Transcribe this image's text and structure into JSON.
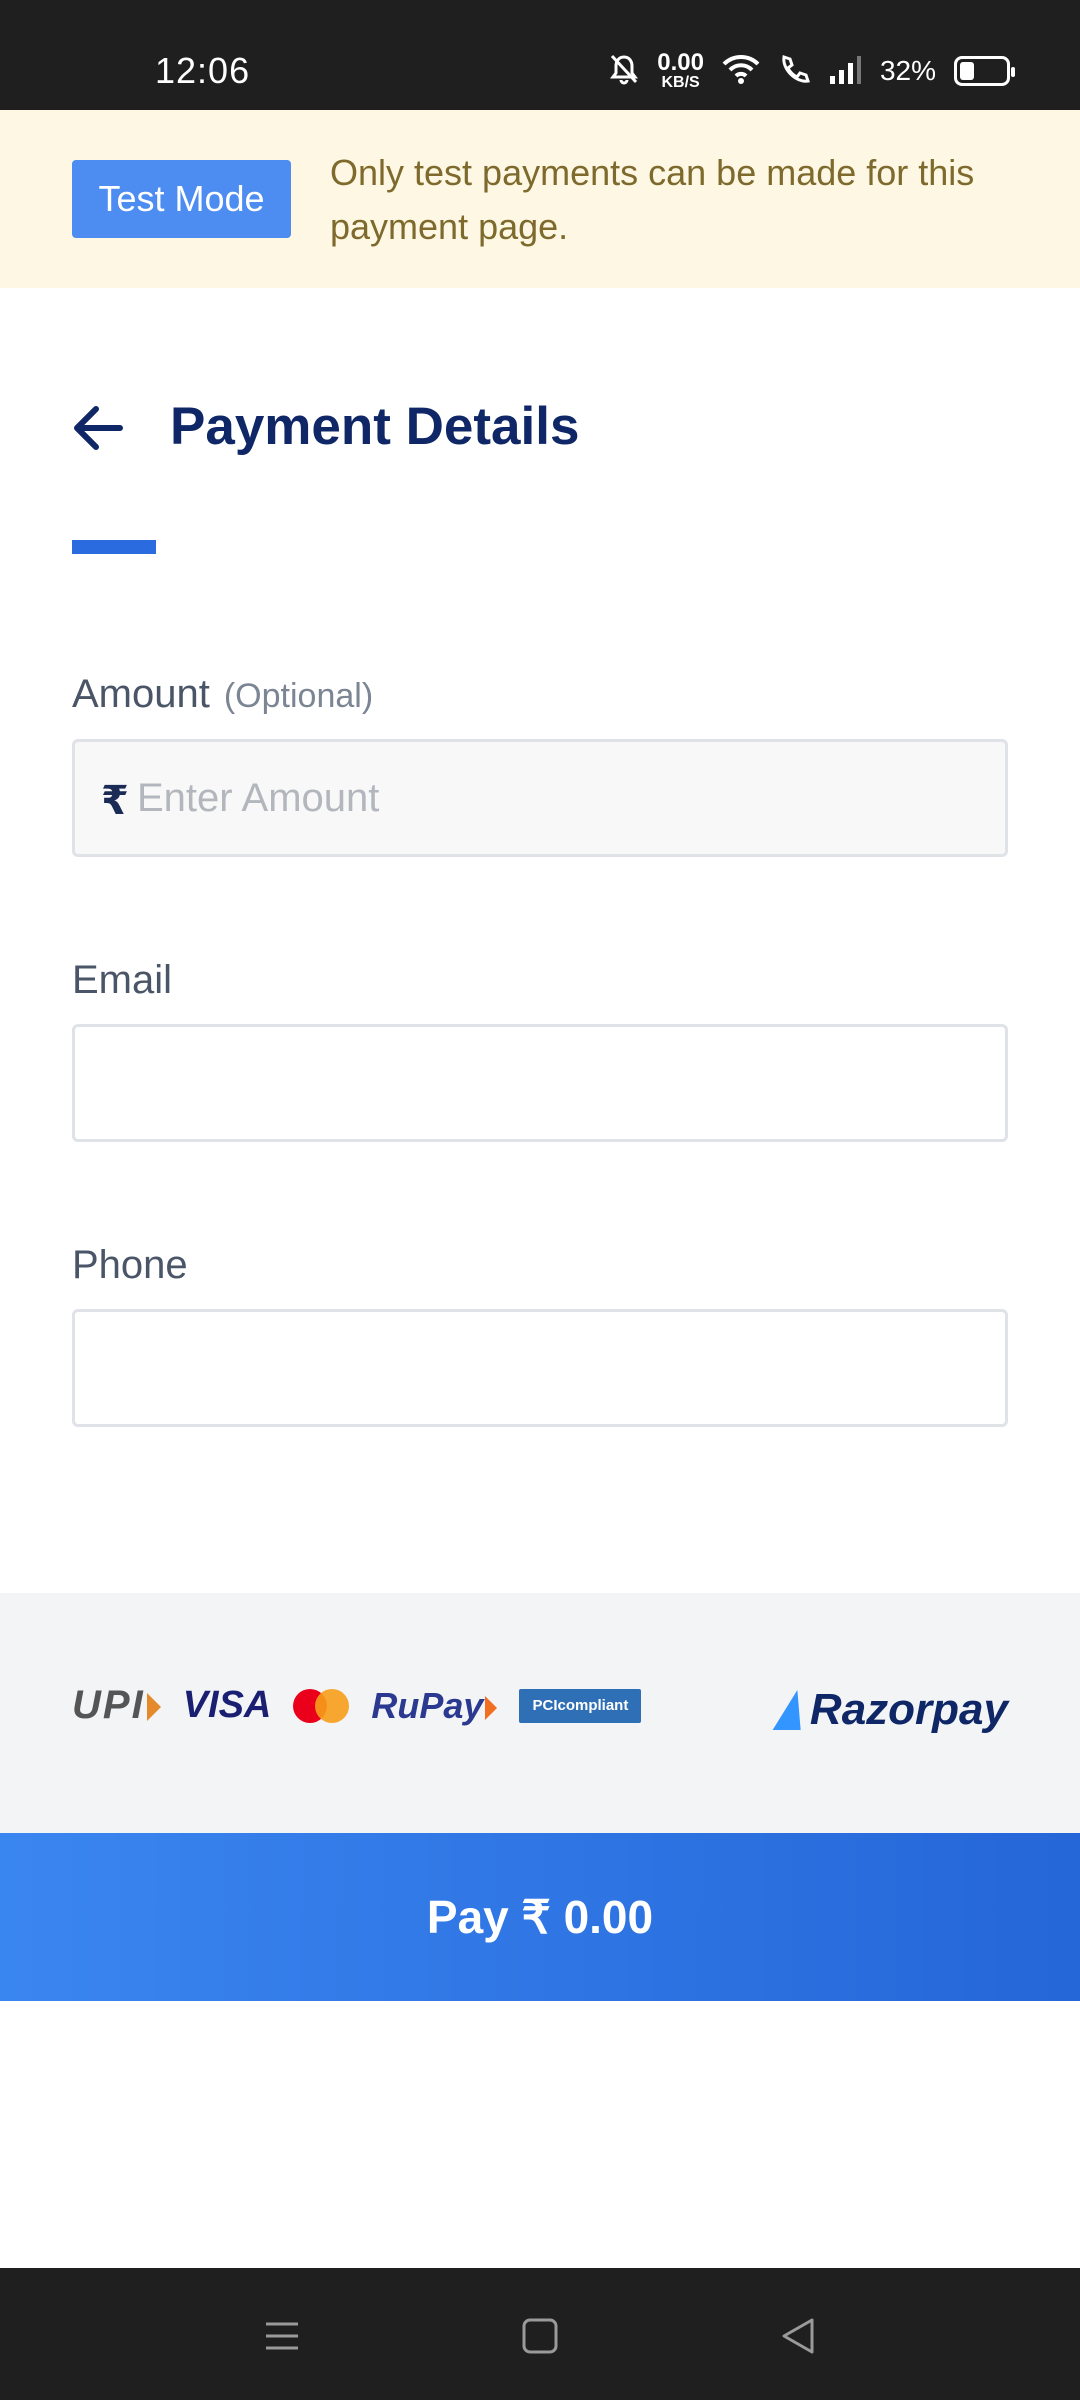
{
  "status_bar": {
    "time": "12:06",
    "net_speed_value": "0.00",
    "net_speed_unit": "KB/S",
    "battery_percent": "32%",
    "battery_level": 0.32
  },
  "banner": {
    "badge": "Test Mode",
    "message": "Only test payments can be made for this payment page."
  },
  "header": {
    "title": "Payment Details"
  },
  "form": {
    "amount": {
      "label": "Amount",
      "optional": "(Optional)",
      "currency_symbol": "₹",
      "placeholder": "Enter Amount",
      "value": ""
    },
    "email": {
      "label": "Email",
      "value": ""
    },
    "phone": {
      "label": "Phone",
      "value": ""
    }
  },
  "logos": {
    "upi": "UPI",
    "visa": "VISA",
    "rupay": "RuPay",
    "pci": "PCIcompliant",
    "brand": "Razorpay"
  },
  "pay_button": {
    "label": "Pay  ₹ 0.00"
  },
  "colors": {
    "accent": "#2a6ce0",
    "title": "#0f2766",
    "banner_bg": "#fdf7e3",
    "badge_bg": "#4d8cf0"
  }
}
